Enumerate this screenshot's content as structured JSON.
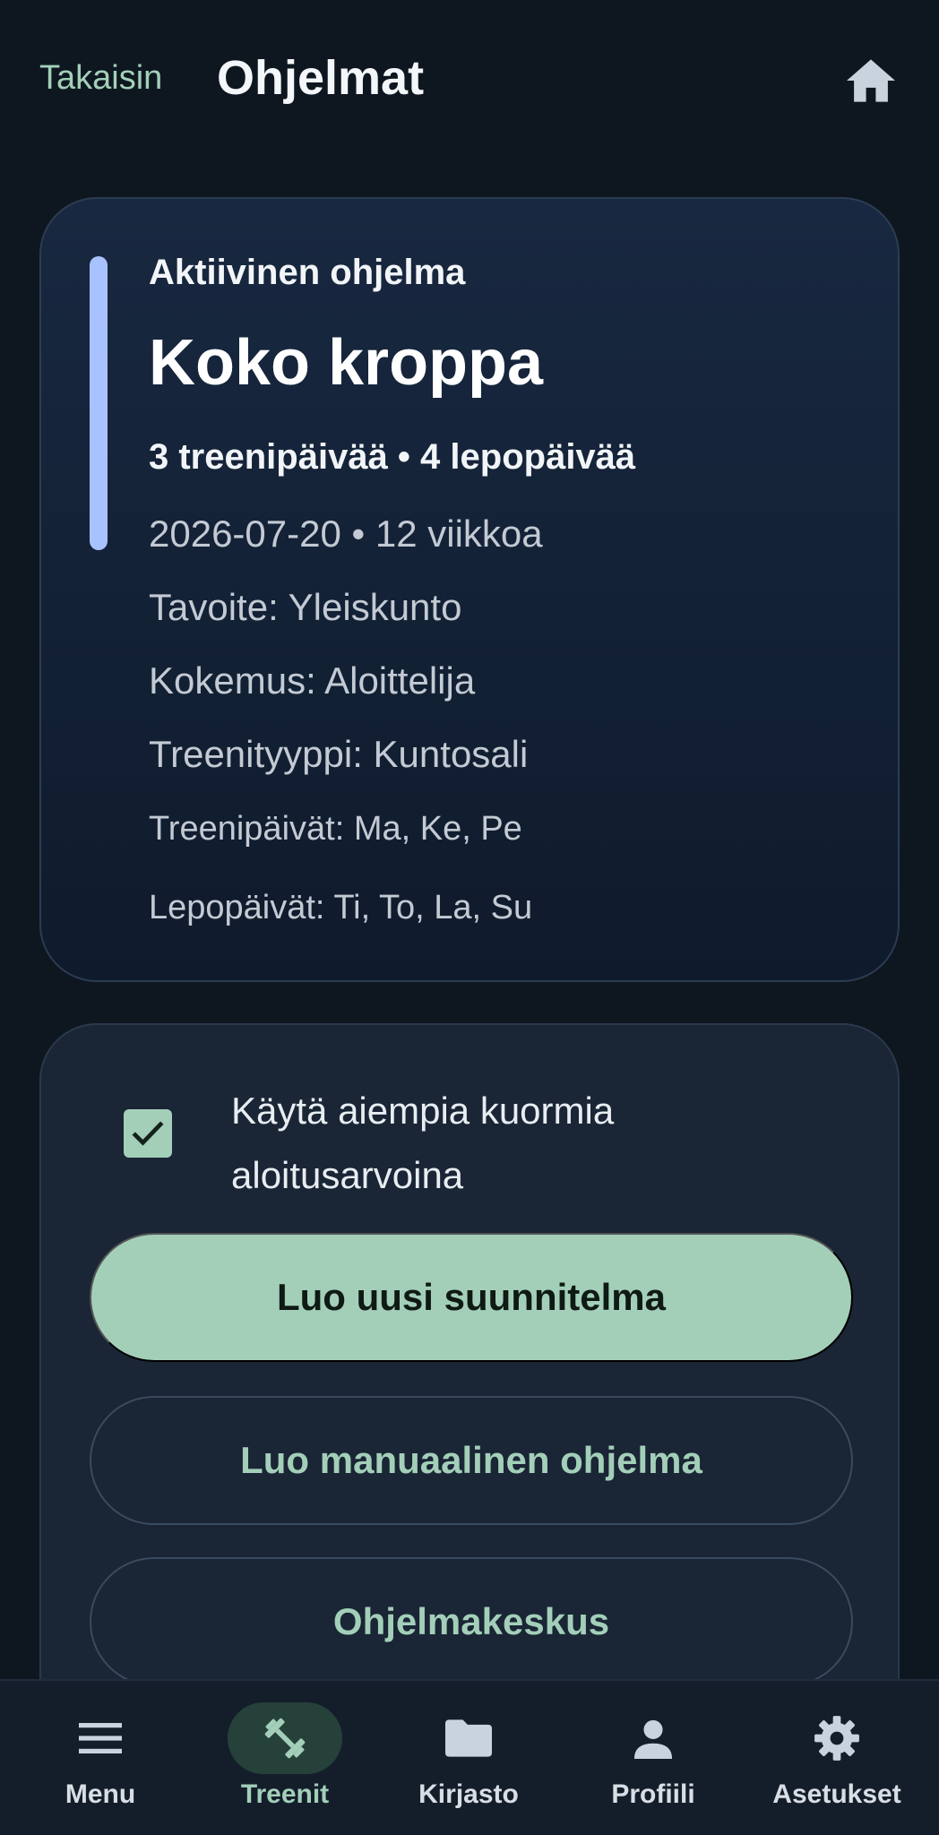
{
  "header": {
    "back_label": "Takaisin",
    "title": "Ohjelmat",
    "home_icon": "home-icon"
  },
  "active_program": {
    "label": "Aktiivinen ohjelma",
    "name": "Koko kroppa",
    "summary": "3 treenipäivää • 4 lepopäivää",
    "start_and_length": "2026-07-20 • 12 viikkoa",
    "goal": "Tavoite: Yleiskunto",
    "experience": "Kokemus: Aloittelija",
    "training_type": "Treenityyppi: Kuntosali",
    "training_days": "Treenipäivät: Ma, Ke, Pe",
    "rest_days": "Lepopäivät: Ti, To, La, Su"
  },
  "actions": {
    "use_previous_loads_label": "Käytä aiempia kuormia aloitusarvoina",
    "use_previous_loads_checked": true,
    "create_plan_label": "Luo uusi suunnitelma",
    "create_manual_label": "Luo manuaalinen ohjelma",
    "program_center_label": "Ohjelmakeskus"
  },
  "bottom_nav": {
    "items": [
      {
        "label": "Menu",
        "icon": "menu-icon",
        "active": false
      },
      {
        "label": "Treenit",
        "icon": "dumbbell-icon",
        "active": true
      },
      {
        "label": "Kirjasto",
        "icon": "folder-icon",
        "active": false
      },
      {
        "label": "Profiili",
        "icon": "person-icon",
        "active": false
      },
      {
        "label": "Asetukset",
        "icon": "gear-icon",
        "active": false
      }
    ]
  },
  "colors": {
    "background": "#0e1720",
    "accent_green": "#a3cfb9",
    "accent_blue": "#a8c2ff",
    "panel": "#1a2535"
  }
}
